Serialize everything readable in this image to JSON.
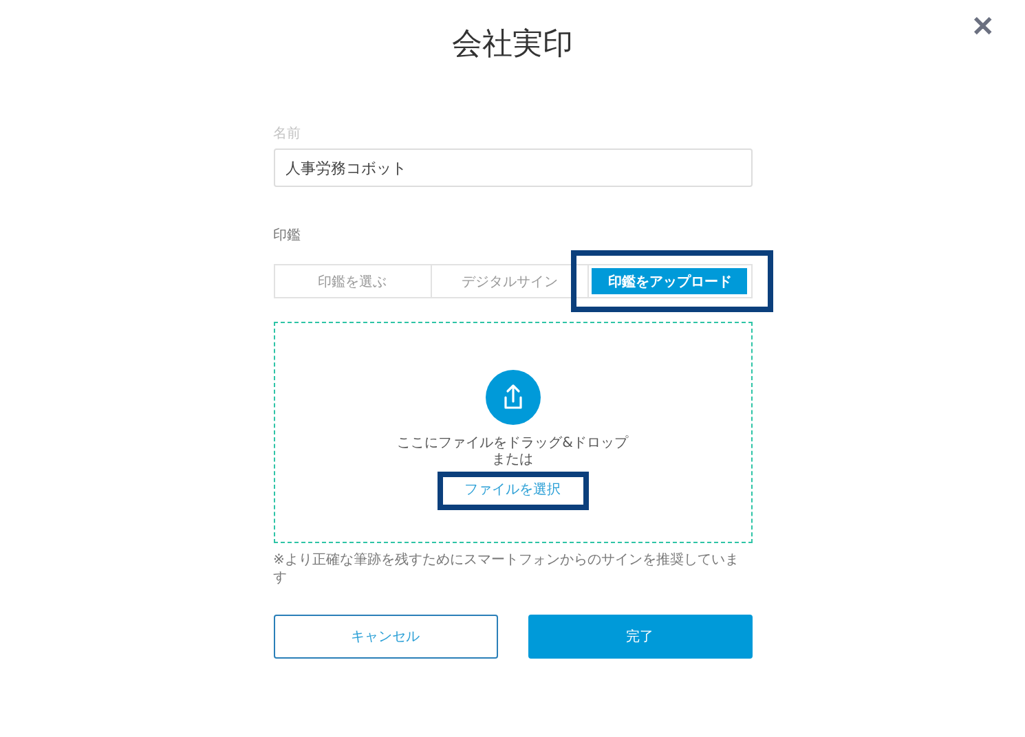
{
  "dialog": {
    "title": "会社実印",
    "close": "✕"
  },
  "name_field": {
    "label": "名前",
    "value": "人事労務コボット"
  },
  "seal": {
    "label": "印鑑",
    "tabs": [
      {
        "label": "印鑑を選ぶ",
        "selected": false,
        "highlighted": false
      },
      {
        "label": "デジタルサイン",
        "selected": false,
        "highlighted": false
      },
      {
        "label": "印鑑をアップロード",
        "selected": true,
        "highlighted": true
      }
    ]
  },
  "dropzone": {
    "instruction": "ここにファイルをドラッグ&ドロップ",
    "or": "または",
    "select_link": {
      "label": "ファイルを選択",
      "highlighted": true
    }
  },
  "note": "※より正確な筆跡を残すためにスマートフォンからのサインを推奨しています",
  "buttons": [
    {
      "label": "キャンセル",
      "kind": "secondary"
    },
    {
      "label": "完了",
      "kind": "primary"
    }
  ]
}
